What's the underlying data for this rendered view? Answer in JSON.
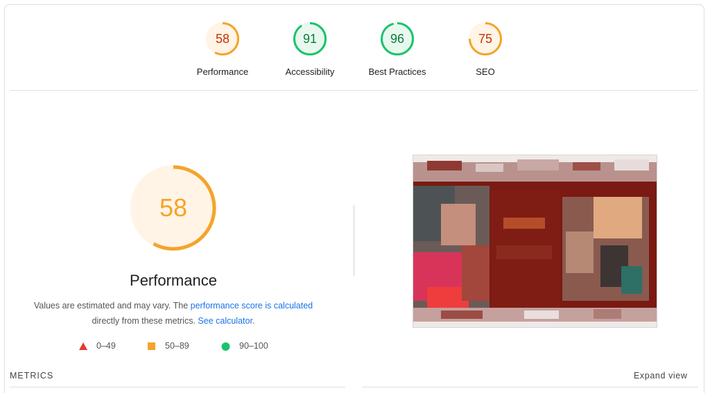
{
  "summary": [
    {
      "label": "Performance",
      "score": "58",
      "value": 58,
      "color": "#f4a42a",
      "text_color": "#c33300",
      "fill": "#fff4e6"
    },
    {
      "label": "Accessibility",
      "score": "91",
      "value": 91,
      "color": "#19c36b",
      "text_color": "#0b7c3c",
      "fill": "#e9f8ef"
    },
    {
      "label": "Best Practices",
      "score": "96",
      "value": 96,
      "color": "#19c36b",
      "text_color": "#0b7c3c",
      "fill": "#e9f8ef"
    },
    {
      "label": "SEO",
      "score": "75",
      "value": 75,
      "color": "#f4a42a",
      "text_color": "#c33300",
      "fill": "#fff4e6"
    }
  ],
  "performance": {
    "score": "58",
    "value": 58,
    "title": "Performance",
    "color": "#f4a42a",
    "fill": "#fff4e6",
    "desc_pre": "Values are estimated and may vary. The ",
    "desc_link1": "performance score is calculated",
    "desc_mid": " directly from these metrics. ",
    "desc_link2": "See calculator",
    "desc_post": "."
  },
  "legend": [
    {
      "label": "0–49",
      "shape": "triangle",
      "color": "#e53935"
    },
    {
      "label": "50–89",
      "shape": "square",
      "color": "#f4a42a"
    },
    {
      "label": "90–100",
      "shape": "circle",
      "color": "#19c36b"
    }
  ],
  "metrics": {
    "label": "METRICS",
    "expand_label": "Expand view"
  }
}
